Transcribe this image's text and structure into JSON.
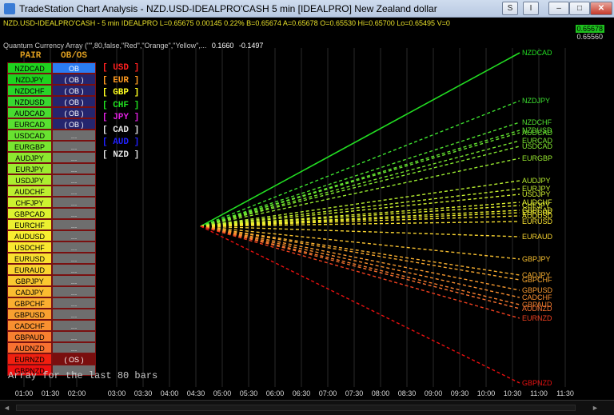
{
  "window": {
    "title": "TradeStation Chart Analysis - NZD.USD-IDEALPRO'CASH 5 min [IDEALPRO] New Zealand dollar",
    "btn_s": "S",
    "btn_i": "I",
    "minimize": "–",
    "maximize": "□",
    "close": "✕",
    "icon": "app-icon"
  },
  "symbol_bar": {
    "text": "NZD.USD-IDEALPRO'CASH - 5 min  IDEALPRO  L=0.65675  0.00145  0.22%  B=0.65674  A=0.65678  O=0.65530  Hi=0.65700  Lo=0.65495  V=0",
    "price_high": "0.65678",
    "price_low": "0.65560",
    "colors": {
      "symbol": "#e8e02a",
      "price_box": "#1ec11e"
    }
  },
  "study": {
    "label": "Quantum Currency Array (\"\",80,false,\"Red\",\"Orange\",\"Yellow\",...",
    "v1": "0.1660",
    "v2": "-0.1497"
  },
  "table": {
    "header_pair": "PAIR",
    "header_obos": "OB/OS",
    "rows": [
      {
        "pair": "NZDCAD",
        "status": "OB",
        "pcolor": "#1fd21f",
        "scolor": "#2b7cf2"
      },
      {
        "pair": "NZDJPY",
        "status": "( OB )",
        "pcolor": "#1fd21f",
        "scolor": "#25256e"
      },
      {
        "pair": "NZDCHF",
        "status": "( OB )",
        "pcolor": "#28d428",
        "scolor": "#25256e"
      },
      {
        "pair": "NZDUSD",
        "status": "( OB )",
        "pcolor": "#38d830",
        "scolor": "#25256e"
      },
      {
        "pair": "AUDCAD",
        "status": "( OB )",
        "pcolor": "#48dc30",
        "scolor": "#25256e"
      },
      {
        "pair": "EURCAD",
        "status": "( OB )",
        "pcolor": "#58e030",
        "scolor": "#25256e"
      },
      {
        "pair": "USDCAD",
        "status": "...",
        "pcolor": "#68e230",
        "scolor": "#6e6e6e"
      },
      {
        "pair": "EURGBP",
        "status": "...",
        "pcolor": "#78e530",
        "scolor": "#6e6e6e"
      },
      {
        "pair": "AUDJPY",
        "status": "...",
        "pcolor": "#8ce830",
        "scolor": "#6e6e6e"
      },
      {
        "pair": "EURJPY",
        "status": "...",
        "pcolor": "#9ceb30",
        "scolor": "#6e6e6e"
      },
      {
        "pair": "USDJPY",
        "status": "...",
        "pcolor": "#acee30",
        "scolor": "#6e6e6e"
      },
      {
        "pair": "AUDCHF",
        "status": "...",
        "pcolor": "#bcf030",
        "scolor": "#6e6e6e"
      },
      {
        "pair": "CHFJPY",
        "status": "...",
        "pcolor": "#ccf230",
        "scolor": "#6e6e6e"
      },
      {
        "pair": "GBPCAD",
        "status": "...",
        "pcolor": "#dcf230",
        "scolor": "#6e6e6e"
      },
      {
        "pair": "EURCHF",
        "status": "...",
        "pcolor": "#ecf030",
        "scolor": "#6e6e6e"
      },
      {
        "pair": "AUDUSD",
        "status": "...",
        "pcolor": "#f8ee30",
        "scolor": "#6e6e6e"
      },
      {
        "pair": "USDCHF",
        "status": "...",
        "pcolor": "#fae830",
        "scolor": "#6e6e6e"
      },
      {
        "pair": "EURUSD",
        "status": "...",
        "pcolor": "#fae030",
        "scolor": "#6e6e6e"
      },
      {
        "pair": "EURAUD",
        "status": "...",
        "pcolor": "#fad430",
        "scolor": "#6e6e6e"
      },
      {
        "pair": "GBPJPY",
        "status": "...",
        "pcolor": "#fac830",
        "scolor": "#6e6e6e"
      },
      {
        "pair": "CADJPY",
        "status": "...",
        "pcolor": "#fabc30",
        "scolor": "#6e6e6e"
      },
      {
        "pair": "GBPCHF",
        "status": "...",
        "pcolor": "#faae30",
        "scolor": "#6e6e6e"
      },
      {
        "pair": "GBPUSD",
        "status": "...",
        "pcolor": "#f8a030",
        "scolor": "#6e6e6e"
      },
      {
        "pair": "CADCHF",
        "status": "...",
        "pcolor": "#f89030",
        "scolor": "#6e6e6e"
      },
      {
        "pair": "GBPAUD",
        "status": "...",
        "pcolor": "#f88030",
        "scolor": "#6e6e6e"
      },
      {
        "pair": "AUDNZD",
        "status": "...",
        "pcolor": "#f87030",
        "scolor": "#6e6e6e"
      },
      {
        "pair": "EURNZD",
        "status": "( OS )",
        "pcolor": "#f02010",
        "scolor": "#7a0e0e"
      },
      {
        "pair": "GBPNZD",
        "status": "...",
        "pcolor": "#ee1010",
        "scolor": "#6e6e6e"
      }
    ]
  },
  "currencies": [
    {
      "label": "[ USD ]",
      "color": "#ff2020"
    },
    {
      "label": "[ EUR ]",
      "color": "#ff9a20"
    },
    {
      "label": "[ GBP ]",
      "color": "#ffff20"
    },
    {
      "label": "[ CHF ]",
      "color": "#20e020"
    },
    {
      "label": "[ JPY ]",
      "color": "#e020e0"
    },
    {
      "label": "[ CAD ]",
      "color": "#e0e0e0"
    },
    {
      "label": "[ AUD ]",
      "color": "#2020ff"
    },
    {
      "label": "[ NZD ]",
      "color": "#e0e0e0"
    }
  ],
  "footer_note": "Array for the last 80 bars",
  "chart_data": {
    "type": "line",
    "origin_time": "04:30",
    "lines": [
      {
        "name": "NZDCAD",
        "y_end": 66,
        "color": "#22dd22",
        "solid": true
      },
      {
        "name": "NZDJPY",
        "y_end": 126,
        "color": "#3ce030"
      },
      {
        "name": "NZDCHF",
        "y_end": 153,
        "color": "#50e030"
      },
      {
        "name": "NZDUSD",
        "y_end": 163,
        "color": "#60e430"
      },
      {
        "name": "AUDCAD",
        "y_end": 166,
        "color": "#6ae430"
      },
      {
        "name": "EURCAD",
        "y_end": 176,
        "color": "#78e630"
      },
      {
        "name": "USDCAD",
        "y_end": 183,
        "color": "#84e830"
      },
      {
        "name": "EURGBP",
        "y_end": 198,
        "color": "#98ea30"
      },
      {
        "name": "AUDJPY",
        "y_end": 226,
        "color": "#b8ee30"
      },
      {
        "name": "EURJPY",
        "y_end": 236,
        "color": "#c4ef30"
      },
      {
        "name": "USDJPY",
        "y_end": 243,
        "color": "#d0f030"
      },
      {
        "name": "AUDCHF",
        "y_end": 253,
        "color": "#dcf030"
      },
      {
        "name": "CHFJPY",
        "y_end": 257,
        "color": "#e4f030"
      },
      {
        "name": "GBPCAD",
        "y_end": 263,
        "color": "#ecf030"
      },
      {
        "name": "EURCHF",
        "y_end": 266,
        "color": "#f0ee30"
      },
      {
        "name": "AUDUSD",
        "y_end": 270,
        "color": "#f6ea30"
      },
      {
        "name": "EURUSD",
        "y_end": 277,
        "color": "#f8e230"
      },
      {
        "name": "EURAUD",
        "y_end": 296,
        "color": "#f8d430"
      },
      {
        "name": "GBPJPY",
        "y_end": 324,
        "color": "#f8c030"
      },
      {
        "name": "CADJPY",
        "y_end": 344,
        "color": "#f8b030"
      },
      {
        "name": "GBPCHF",
        "y_end": 350,
        "color": "#f8a830"
      },
      {
        "name": "GBPUSD",
        "y_end": 363,
        "color": "#f89a30"
      },
      {
        "name": "CADCHF",
        "y_end": 372,
        "color": "#f88e30"
      },
      {
        "name": "GBPAUD",
        "y_end": 381,
        "color": "#f88030"
      },
      {
        "name": "AUDNZD",
        "y_end": 386,
        "color": "#f87030"
      },
      {
        "name": "EURNZD",
        "y_end": 398,
        "color": "#f04020"
      },
      {
        "name": "GBPNZD",
        "y_end": 479,
        "color": "#e81010"
      }
    ],
    "x_ticks": [
      "01:00",
      "01:30",
      "02:00",
      "03:00",
      "03:30",
      "04:00",
      "04:30",
      "05:00",
      "05:30",
      "06:00",
      "06:30",
      "07:00",
      "07:30",
      "08:00",
      "08:30",
      "09:00",
      "09:30",
      "10:00",
      "10:30",
      "11:00",
      "11:30"
    ],
    "grid": "vertical"
  },
  "scrollbar": {
    "left": "◄",
    "right": "►"
  }
}
